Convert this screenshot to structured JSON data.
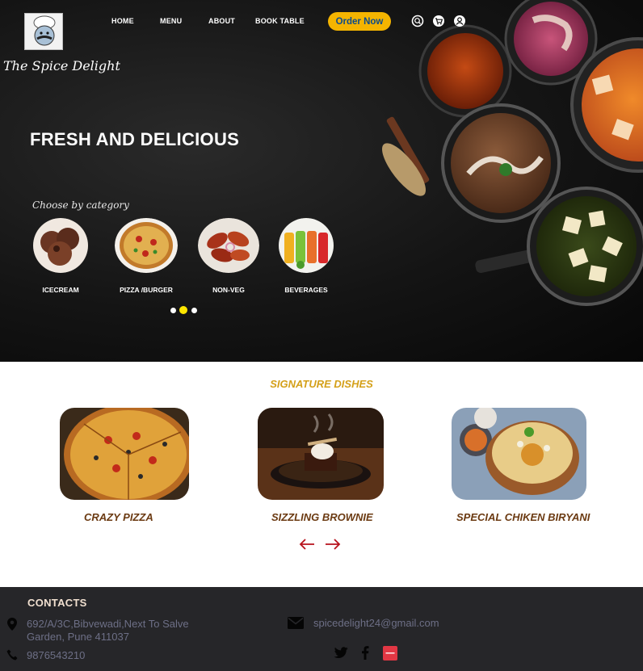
{
  "brand": {
    "name": "The Spice Delight"
  },
  "nav": {
    "home": "HOME",
    "menu": "MENU",
    "about": "ABOUT",
    "book": "BOOK TABLE",
    "order": "Order Now"
  },
  "header_icons": [
    "search-icon",
    "cart-icon",
    "user-icon"
  ],
  "hero": {
    "title": "FRESH AND DELICIOUS",
    "choose": "Choose by category",
    "categories": [
      {
        "label": "ICECREAM"
      },
      {
        "label": "PIZZA /BURGER"
      },
      {
        "label": "NON-VEG"
      },
      {
        "label": "BEVERAGES"
      }
    ],
    "carousel": {
      "count": 3,
      "active": 2
    }
  },
  "signature": {
    "title": "SIGNATURE DISHES",
    "dishes": [
      {
        "name": "CRAZY PIZZA"
      },
      {
        "name": "SIZZLING BROWNIE"
      },
      {
        "name": "SPECIAL CHIKEN BIRYANI"
      }
    ]
  },
  "footer": {
    "contacts": "CONTACTS",
    "address_line1": "692/A/3C,Bibvewadi,Next To Salve",
    "address_line2": "Garden, Pune 411037",
    "phone": "9876543210",
    "email": "spicedelight24@gmail.com",
    "social": [
      "twitter-icon",
      "facebook-icon",
      "zomato-icon"
    ]
  },
  "colors": {
    "accent": "#f4b400",
    "gold_title": "#d4a019",
    "dish_brown": "#6b3a12",
    "footer_bg": "#262629",
    "arrow_red": "#b8121c"
  }
}
